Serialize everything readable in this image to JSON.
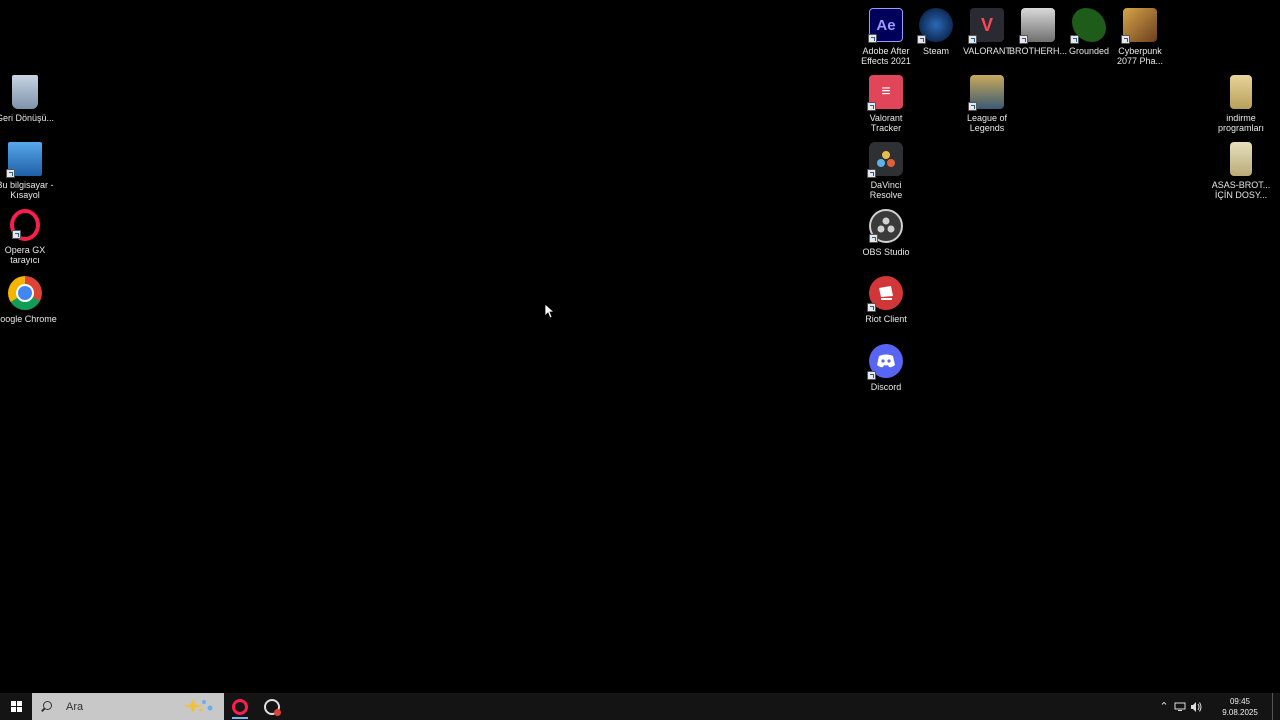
{
  "desktop": {
    "icons": [
      {
        "label": "Adobe After Effects 2021",
        "icon": "after-effects-icon",
        "glyph": "Ae"
      },
      {
        "label": "Steam",
        "icon": "steam-icon"
      },
      {
        "label": "VALORANT",
        "icon": "valorant-icon",
        "glyph": "V"
      },
      {
        "label": "BROTHERH...",
        "icon": "brotherhood-icon"
      },
      {
        "label": "Grounded",
        "icon": "grounded-icon"
      },
      {
        "label": "Cyberpunk 2077 Pha...",
        "icon": "cyberpunk-icon"
      },
      {
        "label": "Valorant Tracker",
        "icon": "valorant-tracker-icon",
        "glyph": "≡"
      },
      {
        "label": "League of Legends",
        "icon": "league-of-legends-icon"
      },
      {
        "label": "DaVinci Resolve",
        "icon": "davinci-resolve-icon"
      },
      {
        "label": "OBS Studio",
        "icon": "obs-studio-icon"
      },
      {
        "label": "Riot Client",
        "icon": "riot-client-icon"
      },
      {
        "label": "Discord",
        "icon": "discord-icon"
      },
      {
        "label": "Geri Dönüşü...",
        "icon": "recycle-bin-icon"
      },
      {
        "label": "Bu bilgisayar - Kısayol",
        "icon": "this-pc-icon"
      },
      {
        "label": "Opera GX tarayıcı",
        "icon": "opera-gx-icon"
      },
      {
        "label": "Google Chrome",
        "icon": "google-chrome-icon"
      },
      {
        "label": "indirme programları",
        "icon": "folder-icon"
      },
      {
        "label": "ASAS-BROT... İÇİN DOSY...",
        "icon": "folder-icon"
      }
    ]
  },
  "taskbar": {
    "search_placeholder": "Ara",
    "apps": [
      {
        "name": "Opera GX",
        "icon": "opera-gx-icon",
        "active": true
      },
      {
        "name": "Snipping Tool",
        "icon": "snipping-tool-icon",
        "active": false
      }
    ],
    "clock": {
      "time": "09:45",
      "date": "9.08.2025"
    }
  },
  "colors": {
    "desktop_bg": "#000000",
    "taskbar_bg": "#141414",
    "search_bg": "#c8c8c8",
    "active_indicator": "#76b9ed"
  }
}
